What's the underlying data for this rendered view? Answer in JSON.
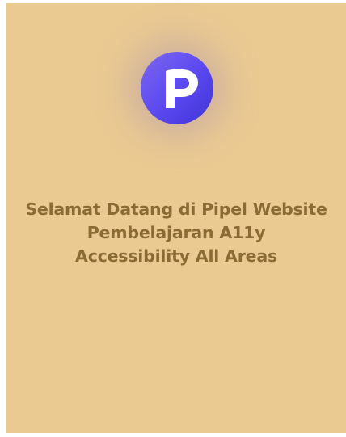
{
  "logo": {
    "icon": "pipel-p-logo-icon",
    "colors": {
      "gradient_start": "#7D66F2",
      "gradient_end": "#3D33D6",
      "glyph": "#FFFFFF"
    }
  },
  "welcome": {
    "line1": "Selamat Datang di Pipel Website",
    "line2": "Pembelajaran A11y",
    "line3": "Accessibility All Areas"
  },
  "theme": {
    "background": "#EBCA92",
    "text": "#8A6B33"
  }
}
